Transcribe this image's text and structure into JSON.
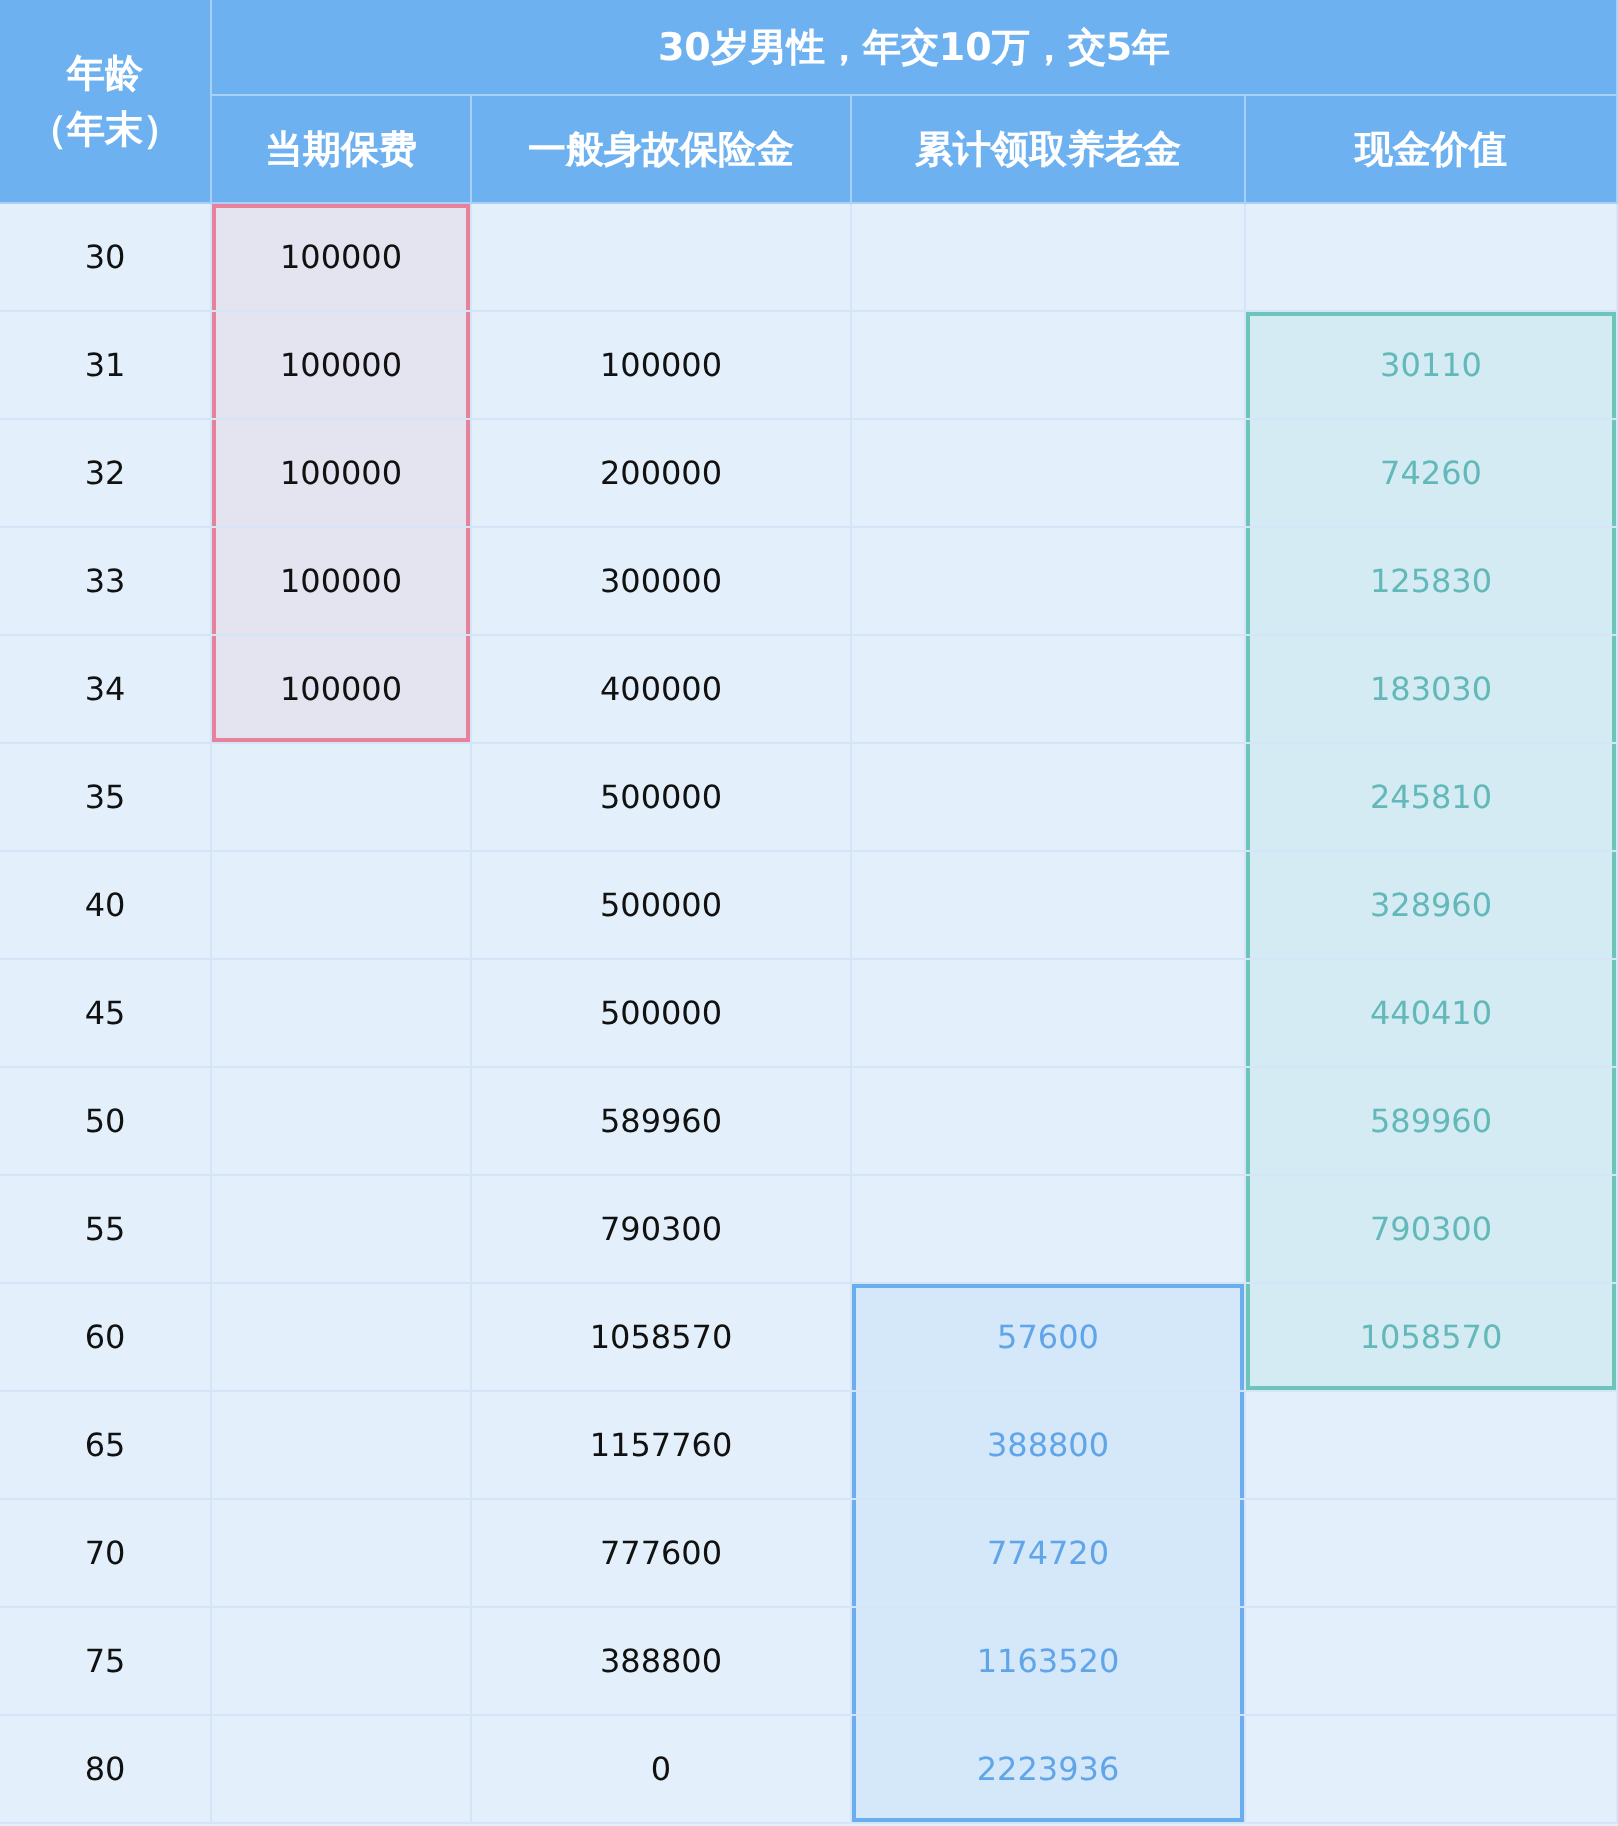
{
  "table": {
    "title": "30岁男性，年交10万，交5年",
    "columns": [
      {
        "label_lines": [
          "年龄",
          "（年末）"
        ]
      },
      {
        "label": "当期保费",
        "color": "#e8829c",
        "colored_text": false
      },
      {
        "label": "一般身故保险金"
      },
      {
        "label": "累计领取养老金",
        "color": "#6aaef0",
        "colored_text": true
      },
      {
        "label": "现金价值",
        "color": "#6cc5b8",
        "colored_text": true
      }
    ],
    "rows": [
      [
        "30",
        "100000",
        null,
        null,
        null
      ],
      [
        "31",
        "100000",
        "100000",
        null,
        "30110"
      ],
      [
        "32",
        "100000",
        "200000",
        null,
        "74260"
      ],
      [
        "33",
        "100000",
        "300000",
        null,
        "125830"
      ],
      [
        "34",
        "100000",
        "400000",
        null,
        "183030"
      ],
      [
        "35",
        null,
        "500000",
        null,
        "245810"
      ],
      [
        "40",
        null,
        "500000",
        null,
        "328960"
      ],
      [
        "45",
        null,
        "500000",
        null,
        "440410"
      ],
      [
        "50",
        null,
        "589960",
        null,
        "589960"
      ],
      [
        "55",
        null,
        "790300",
        null,
        "790300"
      ],
      [
        "60",
        null,
        "1058570",
        "57600",
        "1058570"
      ],
      [
        "65",
        null,
        "1157760",
        "388800",
        null
      ],
      [
        "70",
        null,
        "777600",
        "774720",
        null
      ],
      [
        "75",
        null,
        "388800",
        "1163520",
        null
      ],
      [
        "80",
        null,
        "0",
        "2223936",
        null
      ]
    ]
  }
}
